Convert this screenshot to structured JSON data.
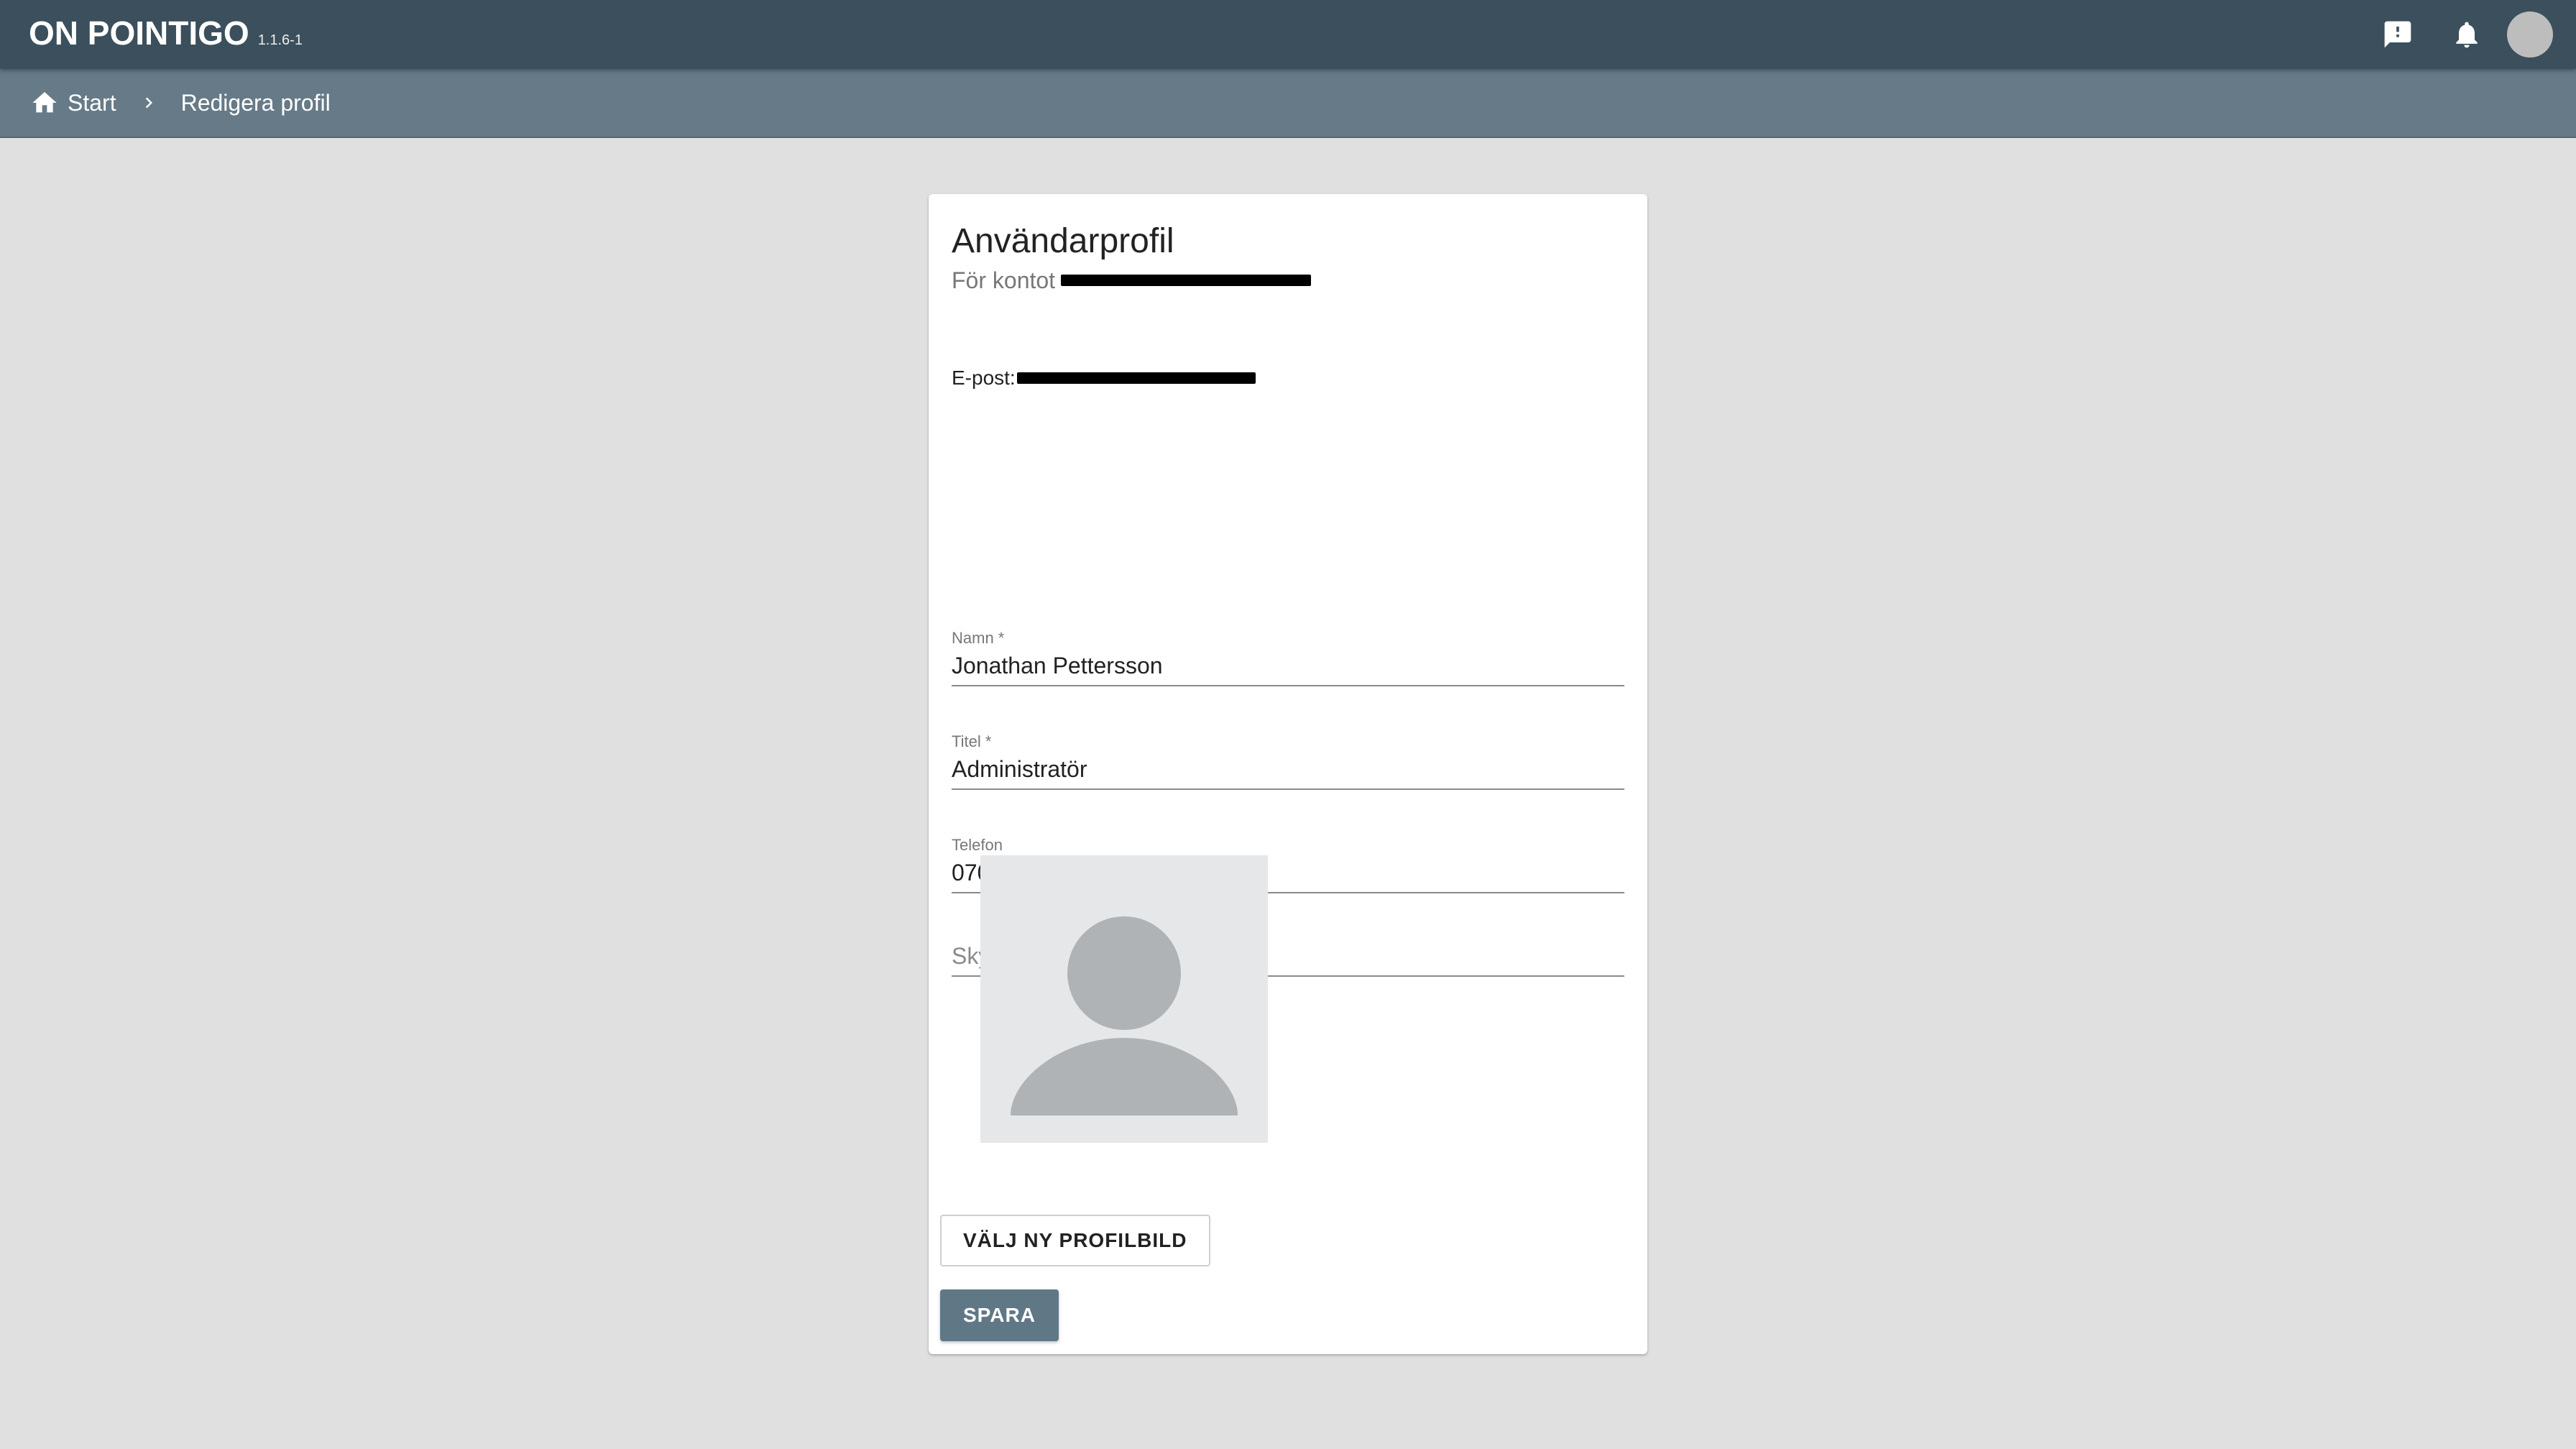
{
  "app": {
    "logo_text": "ON POINTIGO",
    "version": "1.1.6-1"
  },
  "header": {
    "feedback_icon": "feedback-icon",
    "notifications_icon": "bell-icon",
    "avatar": "avatar-circle"
  },
  "breadcrumb": {
    "items": [
      {
        "label": "Start",
        "icon": "home-icon"
      },
      {
        "label": "Redigera profil"
      }
    ]
  },
  "profile": {
    "title": "Användarprofil",
    "subtitle_prefix": "För kontot",
    "email_label": "E-post:",
    "fields": {
      "name": {
        "label": "Namn *",
        "value": "Jonathan Pettersson"
      },
      "title": {
        "label": "Titel *",
        "value": "Administratör"
      },
      "phone": {
        "label": "Telefon",
        "value": "070 XXX XX XX"
      },
      "skype": {
        "label": "",
        "value": "",
        "placeholder": "Skypenamn"
      }
    },
    "choose_photo_label": "VÄLJ NY PROFILBILD",
    "save_label": "SPARA"
  },
  "colors": {
    "topbar": "#3b4f5c",
    "breadcrumb_bar": "#667a87",
    "primary_button": "#607886",
    "page_background": "#e0e0e0"
  }
}
